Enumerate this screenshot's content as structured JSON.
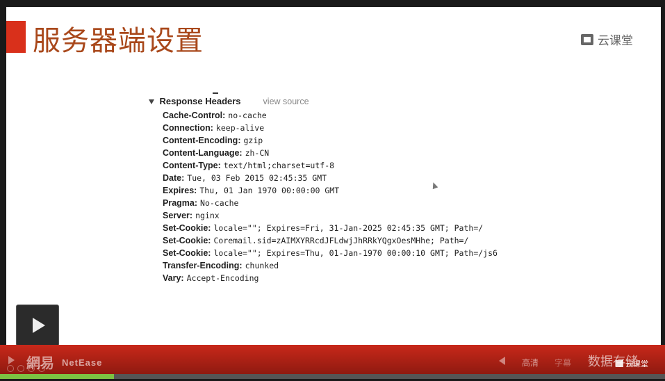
{
  "slide": {
    "title": "服务器端设置",
    "brand": "云课堂"
  },
  "response_headers": {
    "section_title": "Response Headers",
    "view_source_label": "view source",
    "items": [
      {
        "key": "Cache-Control:",
        "value": "no-cache"
      },
      {
        "key": "Connection:",
        "value": "keep-alive"
      },
      {
        "key": "Content-Encoding:",
        "value": "gzip"
      },
      {
        "key": "Content-Language:",
        "value": "zh-CN"
      },
      {
        "key": "Content-Type:",
        "value": "text/html;charset=utf-8"
      },
      {
        "key": "Date:",
        "value": "Tue, 03 Feb 2015 02:45:35 GMT"
      },
      {
        "key": "Expires:",
        "value": "Thu, 01 Jan 1970 00:00:00 GMT"
      },
      {
        "key": "Pragma:",
        "value": "No-cache"
      },
      {
        "key": "Server:",
        "value": "nginx"
      },
      {
        "key": "Set-Cookie:",
        "value": "locale=\"\"; Expires=Fri, 31-Jan-2025 02:45:35 GMT; Path=/"
      },
      {
        "key": "Set-Cookie:",
        "value": "Coremail.sid=zAIMXYRRcdJFLdwjJhRRkYQgxOesMHhe; Path=/"
      },
      {
        "key": "Set-Cookie:",
        "value": "locale=\"\"; Expires=Thu, 01-Jan-1970 00:00:10 GMT; Path=/js6"
      },
      {
        "key": "Transfer-Encoding:",
        "value": "chunked"
      },
      {
        "key": "Vary:",
        "value": "Accept-Encoding"
      }
    ]
  },
  "player": {
    "logo_cn": "網易",
    "logo_en": "NetEase",
    "hd_label": "高清",
    "subtitle_label": "字幕",
    "section_name": "数据存储",
    "brand_small": "云课堂",
    "progress_fraction": 0.171
  },
  "colors": {
    "title_accent": "#d9301b",
    "title_text": "#a9481b",
    "control_bar": "#c8281a",
    "progress": "#7cc242"
  }
}
